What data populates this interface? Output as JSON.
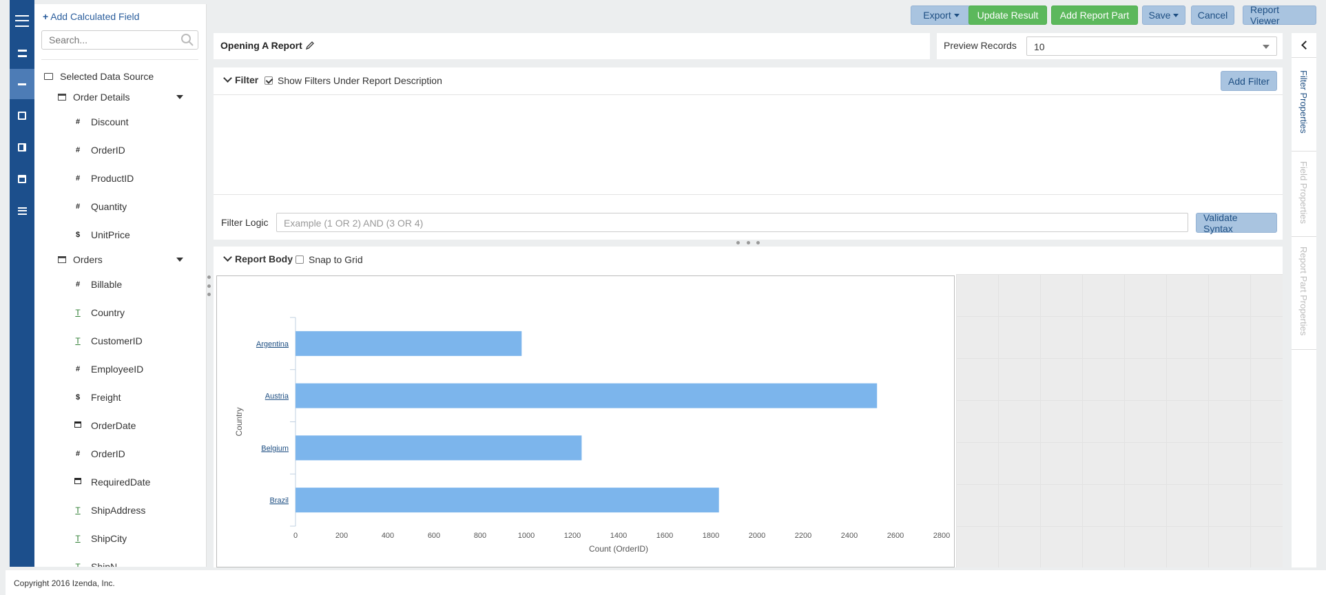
{
  "nav": {
    "icons": [
      "menu-icon",
      "list-icon",
      "report-icon",
      "dashboard-icon",
      "export-icon",
      "calendar-icon",
      "settings-list-icon"
    ]
  },
  "fields": {
    "add_calculated": "Add Calculated Field",
    "search_placeholder": "Search...",
    "data_source": "Selected Data Source",
    "tables": [
      {
        "name": "Order Details",
        "fields": [
          {
            "type": "#",
            "name": "Discount"
          },
          {
            "type": "#",
            "name": "OrderID"
          },
          {
            "type": "#",
            "name": "ProductID"
          },
          {
            "type": "#",
            "name": "Quantity"
          },
          {
            "type": "$",
            "name": "UnitPrice"
          }
        ]
      },
      {
        "name": "Orders",
        "fields": [
          {
            "type": "#",
            "name": "Billable"
          },
          {
            "type": "T",
            "name": "Country"
          },
          {
            "type": "T",
            "name": "CustomerID"
          },
          {
            "type": "#",
            "name": "EmployeeID"
          },
          {
            "type": "$",
            "name": "Freight"
          },
          {
            "type": "cal",
            "name": "OrderDate"
          },
          {
            "type": "#",
            "name": "OrderID"
          },
          {
            "type": "cal",
            "name": "RequiredDate"
          },
          {
            "type": "T",
            "name": "ShipAddress"
          },
          {
            "type": "T",
            "name": "ShipCity"
          },
          {
            "type": "T",
            "name": "ShipN..."
          }
        ]
      }
    ]
  },
  "toolbar": {
    "export": "Export",
    "update_result": "Update Result",
    "add_report_part": "Add Report Part",
    "save": "Save",
    "cancel": "Cancel",
    "report_viewer": "Report Viewer"
  },
  "report": {
    "title": "Opening A Report",
    "preview_label": "Preview Records",
    "preview_value": "10"
  },
  "filter": {
    "heading": "Filter",
    "show_under_desc": "Show Filters Under Report Description",
    "add_filter": "Add Filter",
    "logic_label": "Filter Logic",
    "logic_placeholder": "Example (1 OR 2) AND (3 OR 4)",
    "validate": "Validate Syntax"
  },
  "body": {
    "heading": "Report Body",
    "snap_to_grid": "Snap to Grid"
  },
  "right_tabs": [
    "Filter Properties",
    "Field Properties",
    "Report Part Properties"
  ],
  "footer": "Copyright 2016 Izenda, Inc.",
  "chart_data": {
    "type": "bar",
    "orientation": "horizontal",
    "categories": [
      "Argentina",
      "Austria",
      "Belgium",
      "Brazil"
    ],
    "values": [
      980,
      2520,
      1240,
      1835
    ],
    "xlabel": "Count (OrderID)",
    "ylabel": "Country",
    "xlim": [
      0,
      2800
    ],
    "xticks": [
      0,
      200,
      400,
      600,
      800,
      1000,
      1200,
      1400,
      1600,
      1800,
      2000,
      2200,
      2400,
      2600,
      2800
    ],
    "bar_color": "#7cb5ec"
  }
}
